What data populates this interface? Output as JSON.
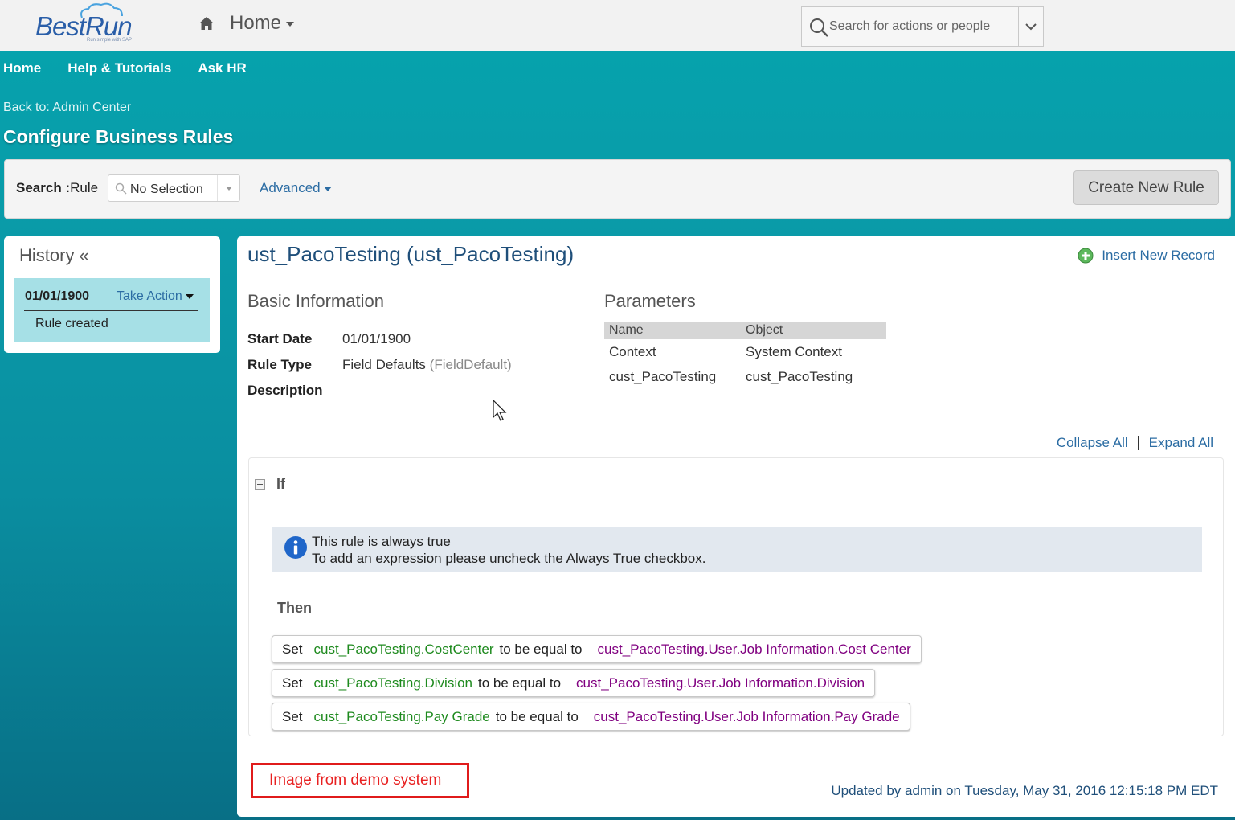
{
  "shell": {
    "logo_text": "BestRun",
    "logo_tagline": "Run simple with SAP",
    "home_label": "Home",
    "search_placeholder": "Search for actions or people"
  },
  "nav": {
    "items": [
      "Home",
      "Help & Tutorials",
      "Ask HR"
    ],
    "back_link": "Back to: Admin Center",
    "page_title": "Configure Business Rules"
  },
  "searchbar": {
    "label_bold": "Search :",
    "label": "Rule",
    "select_value": "No Selection",
    "advanced_label": "Advanced",
    "create_button": "Create New Rule"
  },
  "history": {
    "title": "History «",
    "entry_date": "01/01/1900",
    "entry_action": "Take Action",
    "entry_desc": "Rule created"
  },
  "rule": {
    "title": "ust_PacoTesting (ust_PacoTesting)",
    "insert_link": "Insert New Record",
    "basic_info_title": "Basic Information",
    "start_date_label": "Start Date",
    "start_date": "01/01/1900",
    "rule_type_label": "Rule Type",
    "rule_type": "Field Defaults",
    "rule_type_code": "(FieldDefault)",
    "description_label": "Description",
    "parameters_title": "Parameters",
    "param_headers": [
      "Name",
      "Object"
    ],
    "params": [
      {
        "name": "Context",
        "object": "System Context"
      },
      {
        "name": "cust_PacoTesting",
        "object": "cust_PacoTesting"
      }
    ],
    "collapse_all": "Collapse All",
    "expand_all": "Expand All",
    "if_label": "If",
    "info_line1": "This rule is always true",
    "info_line2": "To add an expression please uncheck the Always True checkbox.",
    "then_label": "Then",
    "statements": [
      {
        "kw": "Set",
        "field": "cust_PacoTesting.CostCenter",
        "op": "to be equal to",
        "source": "cust_PacoTesting.User.Job Information.Cost Center"
      },
      {
        "kw": "Set",
        "field": "cust_PacoTesting.Division",
        "op": "to be equal to",
        "source": "cust_PacoTesting.User.Job Information.Division"
      },
      {
        "kw": "Set",
        "field": "cust_PacoTesting.Pay Grade",
        "op": "to be equal to",
        "source": "cust_PacoTesting.User.Job Information.Pay Grade"
      }
    ],
    "demo_note": "Image from demo system",
    "updated": "Updated by admin on Tuesday, May 31, 2016 12:15:18 PM EDT"
  },
  "colors": {
    "teal": "#05a4ae",
    "link": "#2b6ca3",
    "field_green": "#1e8a1e",
    "source_purple": "#800080",
    "annotation_red": "#e01b1b"
  }
}
